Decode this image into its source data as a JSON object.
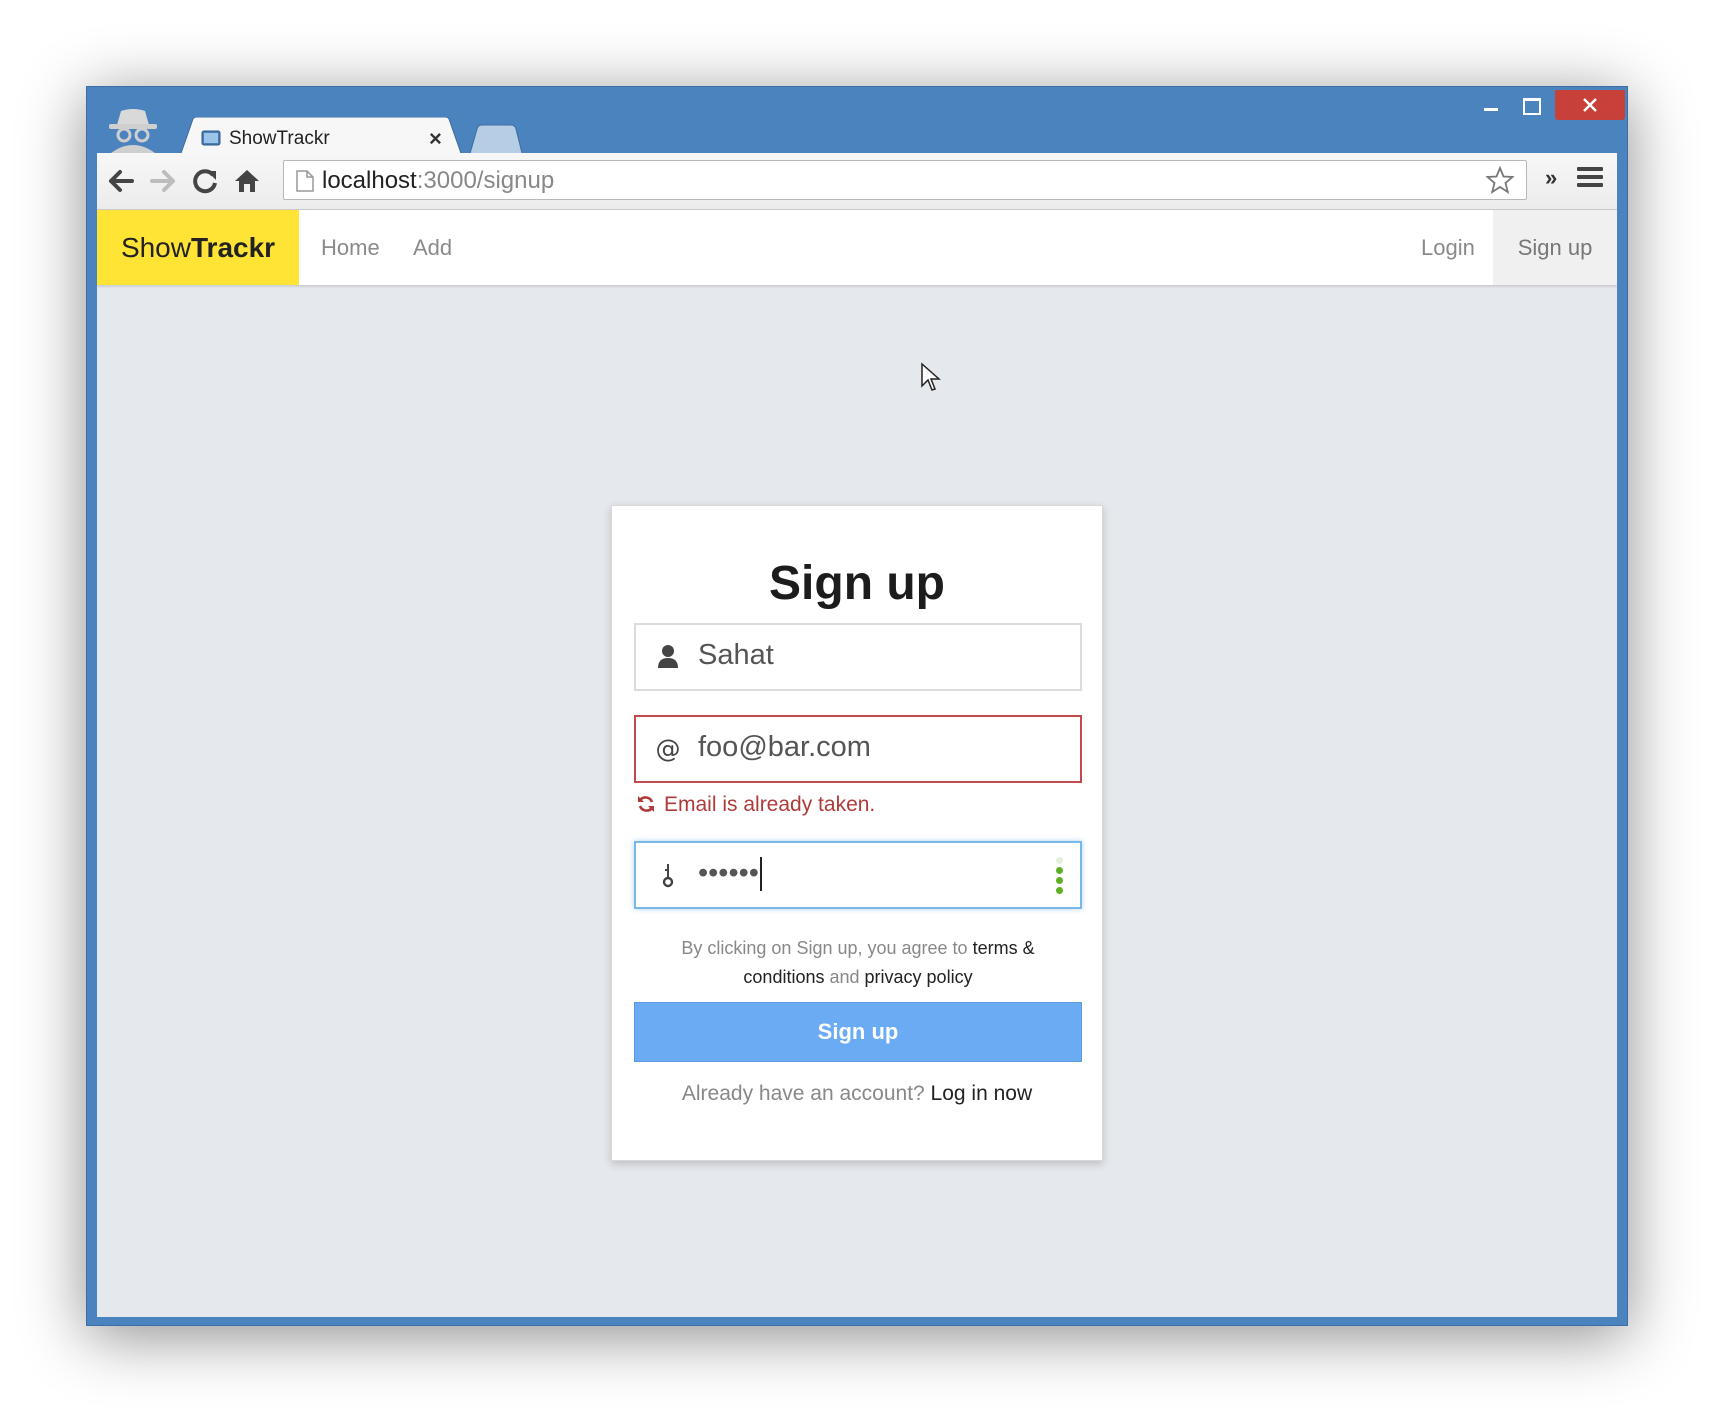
{
  "browser": {
    "tab_title": "ShowTrackr",
    "tab_close": "×",
    "url_host": "localhost",
    "url_rest": ":3000/signup",
    "extensions_chevron": "»"
  },
  "navbar": {
    "brand_light": "Show",
    "brand_bold": "Trackr",
    "links": [
      "Home",
      "Add"
    ],
    "login": "Login",
    "signup": "Sign up"
  },
  "form": {
    "title": "Sign up",
    "name_value": "Sahat",
    "email_value": "foo@bar.com",
    "email_error": "Email is already taken.",
    "password_masked": "••••••",
    "terms_prefix": "By clicking on Sign up, you agree to ",
    "terms_link": "terms & conditions",
    "terms_and": " and ",
    "privacy_link": "privacy policy",
    "submit_label": "Sign up",
    "already_text": "Already have an account? ",
    "login_link": "Log in now"
  },
  "colors": {
    "window_frame": "#4a83bd",
    "brand_bg": "#ffe436",
    "error": "#b03a3a",
    "primary_button": "#6aabf4",
    "page_bg": "#e5e8ec"
  },
  "icons": {
    "name_field": "user-icon",
    "email_field": "at-icon",
    "password_field": "key-icon",
    "error": "refresh-icon"
  }
}
